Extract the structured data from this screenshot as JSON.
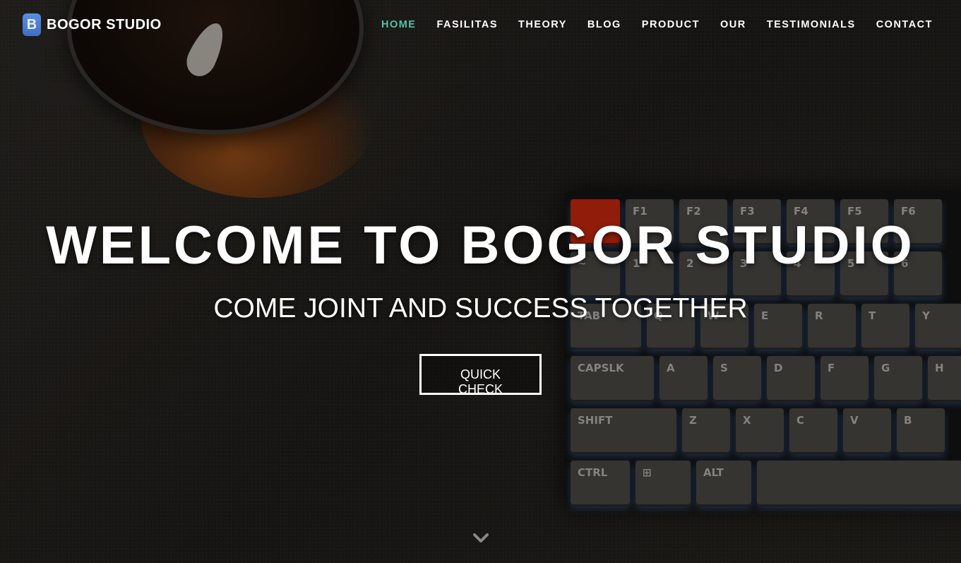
{
  "brand": {
    "logo_letter": "B",
    "name": "BOGOR STUDIO"
  },
  "nav": {
    "items": [
      {
        "label": "HOME",
        "active": true
      },
      {
        "label": "FASILITAS",
        "active": false
      },
      {
        "label": "THEORY",
        "active": false
      },
      {
        "label": "BLOG",
        "active": false
      },
      {
        "label": "PRODUCT",
        "active": false
      },
      {
        "label": "OUR",
        "active": false
      },
      {
        "label": "TESTIMONIALS",
        "active": false
      },
      {
        "label": "CONTACT",
        "active": false
      }
    ]
  },
  "hero": {
    "title": "WELCOME TO BOGOR STUDIO",
    "subtitle": "COME JOINT AND SUCCESS TOGETHER",
    "cta_label": "QUICK CHECK",
    "scroll_icon": "chevron-down-icon"
  },
  "colors": {
    "accent": "#4fc3a8",
    "text": "#ffffff",
    "logo": "#4a7fd6"
  }
}
